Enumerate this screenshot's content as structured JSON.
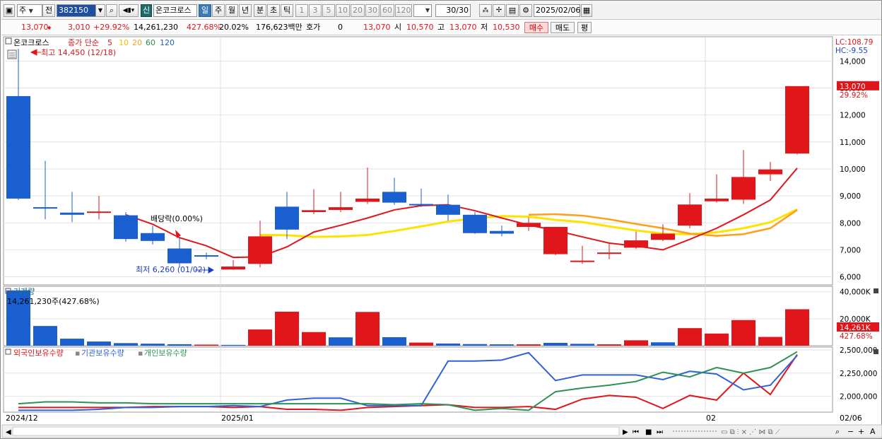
{
  "toolbar": {
    "market_label": "주",
    "prev_label": "전",
    "stock_code": "382150",
    "stock_name": "온코크로스",
    "badge_new": "신",
    "periods": [
      "일",
      "주",
      "월",
      "년",
      "분",
      "초",
      "틱"
    ],
    "active_period": "일",
    "intervals": [
      "1",
      "3",
      "5",
      "10",
      "20",
      "30",
      "60",
      "120"
    ],
    "count": "30",
    "count_total": "/30",
    "date": "2025/02/06"
  },
  "quote": {
    "price": "13,070",
    "change": "3,010",
    "change_pct": "+29.92%",
    "volume": "14,261,230",
    "volume_pct": "427.68%",
    "turnover": "20.02%",
    "amount": "176,623백만",
    "hoga_label": "호가",
    "hoga_value": "0",
    "hoga_price": "13,070",
    "open_label": "시",
    "open": "10,570",
    "high_label": "고",
    "high": "13,070",
    "low_label": "저",
    "low": "10,530",
    "buy_label": "매수",
    "sell_label": "매도",
    "eval_label": "평"
  },
  "price_panel": {
    "title": "온코크로스",
    "ma_label": "종가 단순",
    "ma_periods": [
      "5",
      "10",
      "20",
      "60",
      "120"
    ],
    "high_marker": "최고 14,450 (12/18)",
    "low_marker": "최저 6,260 (01/02)",
    "dividend_marker": "배당락(0.00%)",
    "lc": "LC:108.79",
    "hc": "HC:-9.55",
    "y_ticks": [
      "14,000",
      "13,000",
      "12,000",
      "11,000",
      "10,000",
      "9,000",
      "8,000",
      "7,000",
      "6,000"
    ],
    "last_price_tag": "13,070",
    "last_pct_tag": "29.92%"
  },
  "volume_panel": {
    "title": "거래량",
    "readout": "14,261,230주(427.68%)",
    "y_ticks": [
      "40,000K",
      "20,000K"
    ],
    "last_tag": "14,261K",
    "last_pct": "427.68%"
  },
  "holding_panel": {
    "series_names": [
      "외국인보유수량",
      "기관보유수량",
      "개인보유수량"
    ],
    "y_ticks": [
      "2,500,000",
      "2,250,000",
      "2,000,000"
    ]
  },
  "x_labels": [
    "2024/12",
    "2025/01",
    "02",
    "02/06"
  ],
  "colors": {
    "up": "#e0161b",
    "down": "#1a5fd0",
    "ma5": "#e0161b",
    "ma10": "#ffe300",
    "ma20": "#ff9d1c",
    "ma60": "#2e8a4e",
    "ma120": "#2060c0",
    "foreign": "#e0161b",
    "institution": "#2f62d8",
    "individual": "#2e9255"
  },
  "chart_data": [
    {
      "type": "candlestick",
      "title": "온코크로스",
      "dates": [
        "12/18",
        "12/19",
        "12/20",
        "12/23",
        "12/24",
        "12/26",
        "12/27",
        "12/30",
        "01/02",
        "01/03",
        "01/06",
        "01/07",
        "01/08",
        "01/09",
        "01/10",
        "01/13",
        "01/14",
        "01/15",
        "01/16",
        "01/17",
        "01/20",
        "01/21",
        "01/22",
        "01/23",
        "01/24",
        "01/31",
        "02/03",
        "02/04",
        "02/05",
        "02/06"
      ],
      "open": [
        12700,
        8580,
        8380,
        8380,
        8280,
        7620,
        7050,
        6800,
        6270,
        6480,
        8600,
        8400,
        8480,
        8780,
        9150,
        8700,
        8670,
        8300,
        7700,
        7850,
        6840,
        6570,
        6900,
        7080,
        7370,
        7900,
        8800,
        8860,
        9800,
        10570
      ],
      "close": [
        8900,
        8540,
        8300,
        8420,
        7400,
        7330,
        6500,
        6770,
        6380,
        7500,
        7750,
        8470,
        8580,
        8900,
        8750,
        8650,
        8300,
        7620,
        7600,
        8000,
        7850,
        6600,
        6900,
        7350,
        7600,
        8680,
        8900,
        9700,
        9980,
        13070
      ],
      "high": [
        14450,
        10300,
        9150,
        9000,
        8400,
        7900,
        7450,
        6900,
        6620,
        8080,
        9150,
        9250,
        9150,
        10050,
        9670,
        9270,
        9050,
        8400,
        7900,
        8200,
        7850,
        7150,
        7250,
        7680,
        7950,
        9100,
        9800,
        10700,
        10260,
        13070
      ],
      "low": [
        8850,
        8130,
        8030,
        8130,
        7300,
        7200,
        6350,
        6650,
        6260,
        6350,
        7400,
        8320,
        8400,
        8700,
        8670,
        8590,
        8080,
        7590,
        7500,
        7700,
        6800,
        6480,
        6650,
        7030,
        7320,
        7800,
        8750,
        8700,
        9550,
        10530
      ],
      "ma5": [
        null,
        null,
        null,
        null,
        8300,
        7950,
        7450,
        7150,
        6720,
        6740,
        7110,
        7660,
        7910,
        8180,
        8480,
        8640,
        8670,
        8450,
        8180,
        7920,
        7720,
        7480,
        7250,
        7140,
        7000,
        7390,
        7800,
        8300,
        8850,
        10030
      ],
      "ma10": [
        null,
        null,
        null,
        null,
        null,
        null,
        null,
        null,
        null,
        7550,
        7540,
        7480,
        7500,
        7550,
        7700,
        7870,
        8050,
        8170,
        8250,
        8230,
        8110,
        8030,
        7870,
        7720,
        7600,
        7580,
        7650,
        7800,
        8020,
        8500
      ],
      "ma20": [
        null,
        null,
        null,
        null,
        null,
        null,
        null,
        null,
        null,
        null,
        null,
        null,
        null,
        null,
        null,
        null,
        null,
        null,
        null,
        8300,
        8320,
        8270,
        8130,
        7960,
        7800,
        7600,
        7520,
        7580,
        7800,
        8480
      ],
      "y_range": [
        5700,
        14900
      ]
    },
    {
      "type": "bar",
      "title": "거래량",
      "values": [
        41000,
        14600,
        5200,
        3100,
        1900,
        1500,
        1100,
        800,
        600,
        12000,
        25200,
        10100,
        6200,
        25000,
        6300,
        2300,
        1600,
        1200,
        1000,
        1000,
        2100,
        1400,
        1000,
        4000,
        2500,
        13000,
        9000,
        19000,
        6500,
        27000
      ],
      "up": [
        false,
        false,
        false,
        false,
        false,
        false,
        false,
        true,
        false,
        true,
        true,
        true,
        false,
        true,
        false,
        true,
        false,
        false,
        false,
        true,
        false,
        false,
        true,
        true,
        false,
        true,
        true,
        true,
        true,
        true
      ],
      "unit": "K",
      "y_range": [
        0,
        44000
      ]
    },
    {
      "type": "line",
      "series": [
        {
          "name": "외국인보유수량",
          "values": [
            1880000,
            1880000,
            1880000,
            1880000,
            1880000,
            1890000,
            1890000,
            1890000,
            1880000,
            1890000,
            1860000,
            1860000,
            1850000,
            1880000,
            1890000,
            1900000,
            1910000,
            1880000,
            1880000,
            1890000,
            1860000,
            1970000,
            2010000,
            1990000,
            1870000,
            2010000,
            1960000,
            2250000,
            2020000,
            2450000
          ]
        },
        {
          "name": "기관보유수량",
          "values": [
            1850000,
            1850000,
            1850000,
            1860000,
            1880000,
            1880000,
            1890000,
            1890000,
            1900000,
            1890000,
            1960000,
            1980000,
            1980000,
            1900000,
            1900000,
            1900000,
            2380000,
            2380000,
            2390000,
            2470000,
            2170000,
            2230000,
            2230000,
            2230000,
            2180000,
            2270000,
            2240000,
            2070000,
            2120000,
            2440000
          ]
        },
        {
          "name": "개인보유수량",
          "values": [
            1920000,
            1940000,
            1940000,
            1930000,
            1930000,
            1920000,
            1920000,
            1920000,
            1920000,
            1920000,
            1920000,
            1920000,
            1920000,
            1920000,
            1910000,
            1920000,
            1910000,
            1850000,
            1870000,
            1850000,
            2050000,
            2090000,
            2120000,
            2160000,
            2260000,
            2210000,
            2310000,
            2250000,
            2310000,
            2480000
          ]
        }
      ],
      "y_range": [
        1830000,
        2530000
      ]
    }
  ]
}
